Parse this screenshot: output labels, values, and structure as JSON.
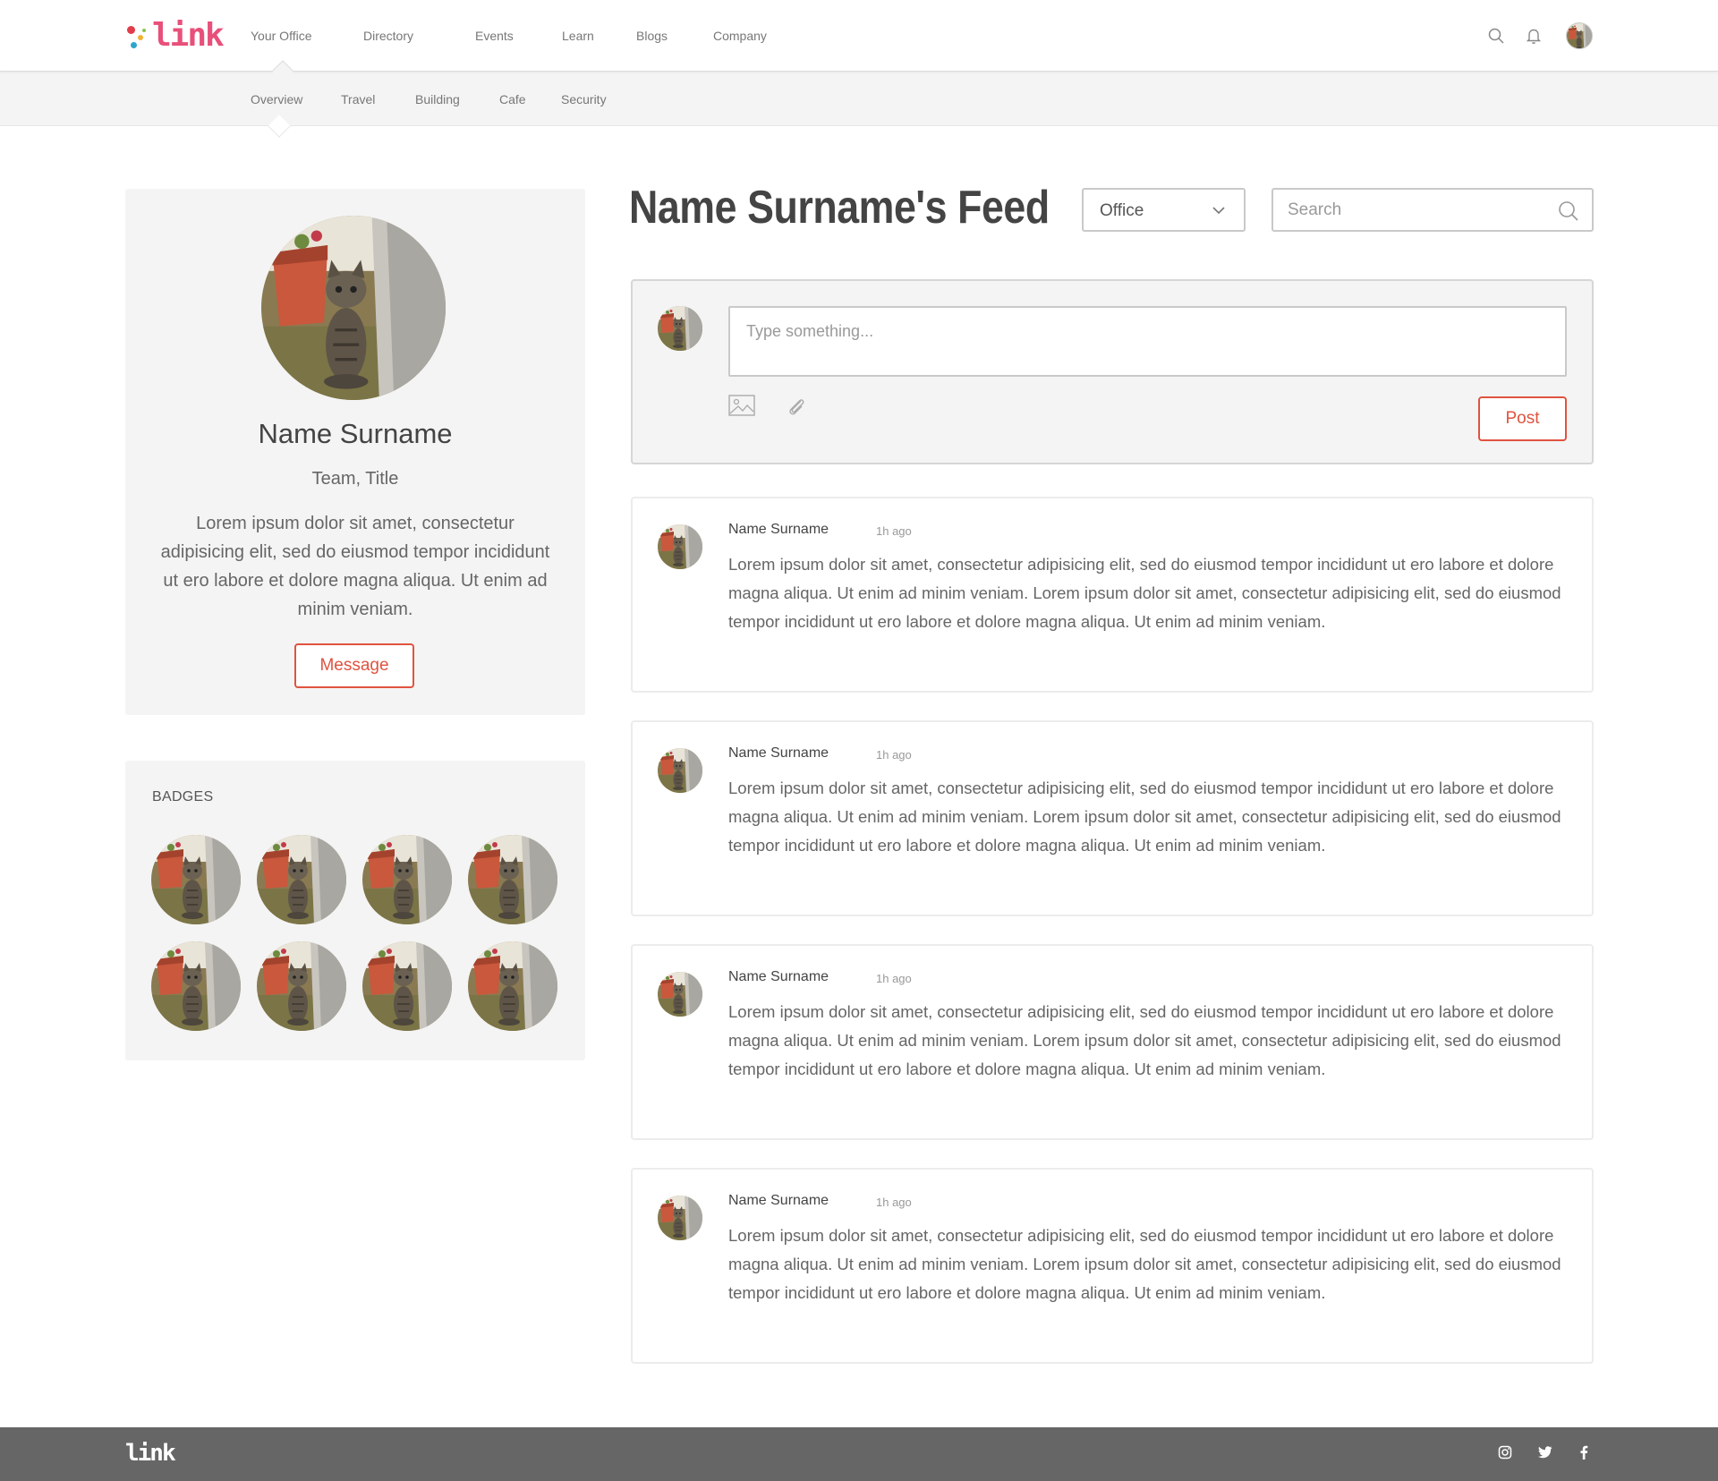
{
  "app": {
    "logo_text": "link"
  },
  "colors": {
    "accent": "#e0533f",
    "brand_pink": "#e8507a",
    "panel_bg": "#f4f4f4",
    "footer_bg": "#666666"
  },
  "topnav": {
    "items": [
      "Your Office",
      "Directory",
      "Events",
      "Learn",
      "Blogs",
      "Company"
    ],
    "active": "Your Office",
    "icons": [
      "search-icon",
      "bell-icon",
      "user-avatar"
    ]
  },
  "subnav": {
    "items": [
      "Overview",
      "Travel",
      "Building",
      "Cafe",
      "Security"
    ],
    "active": "Overview"
  },
  "profile": {
    "name": "Name Surname",
    "title": "Team, Title",
    "bio": "Lorem ipsum dolor sit amet, consectetur adipisicing elit, sed do eiusmod tempor incididunt ut ero labore et dolore magna aliqua. Ut enim ad minim veniam.",
    "message_label": "Message"
  },
  "badges": {
    "title": "BADGES",
    "count": 8
  },
  "feed": {
    "title": "Name Surname's Feed",
    "filter_value": "Office",
    "search_placeholder": "Search",
    "composer_placeholder": "Type something...",
    "post_label": "Post",
    "posts": [
      {
        "author": "Name Surname",
        "time": "1h ago",
        "body": "Lorem ipsum dolor sit amet, consectetur adipisicing elit, sed do eiusmod tempor incididunt ut ero labore et dolore magna aliqua. Ut enim ad minim veniam. Lorem ipsum dolor sit amet, consectetur adipisicing elit, sed do eiusmod tempor incididunt ut ero labore et dolore magna aliqua. Ut enim ad minim veniam."
      },
      {
        "author": "Name Surname",
        "time": "1h ago",
        "body": "Lorem ipsum dolor sit amet, consectetur adipisicing elit, sed do eiusmod tempor incididunt ut ero labore et dolore magna aliqua. Ut enim ad minim veniam. Lorem ipsum dolor sit amet, consectetur adipisicing elit, sed do eiusmod tempor incididunt ut ero labore et dolore magna aliqua. Ut enim ad minim veniam."
      },
      {
        "author": "Name Surname",
        "time": "1h ago",
        "body": "Lorem ipsum dolor sit amet, consectetur adipisicing elit, sed do eiusmod tempor incididunt ut ero labore et dolore magna aliqua. Ut enim ad minim veniam. Lorem ipsum dolor sit amet, consectetur adipisicing elit, sed do eiusmod tempor incididunt ut ero labore et dolore magna aliqua. Ut enim ad minim veniam."
      },
      {
        "author": "Name Surname",
        "time": "1h ago",
        "body": "Lorem ipsum dolor sit amet, consectetur adipisicing elit, sed do eiusmod tempor incididunt ut ero labore et dolore magna aliqua. Ut enim ad minim veniam. Lorem ipsum dolor sit amet, consectetur adipisicing elit, sed do eiusmod tempor incididunt ut ero labore et dolore magna aliqua. Ut enim ad minim veniam."
      }
    ]
  },
  "footer": {
    "logo_text": "link",
    "socials": [
      "instagram-icon",
      "twitter-icon",
      "facebook-icon"
    ]
  }
}
